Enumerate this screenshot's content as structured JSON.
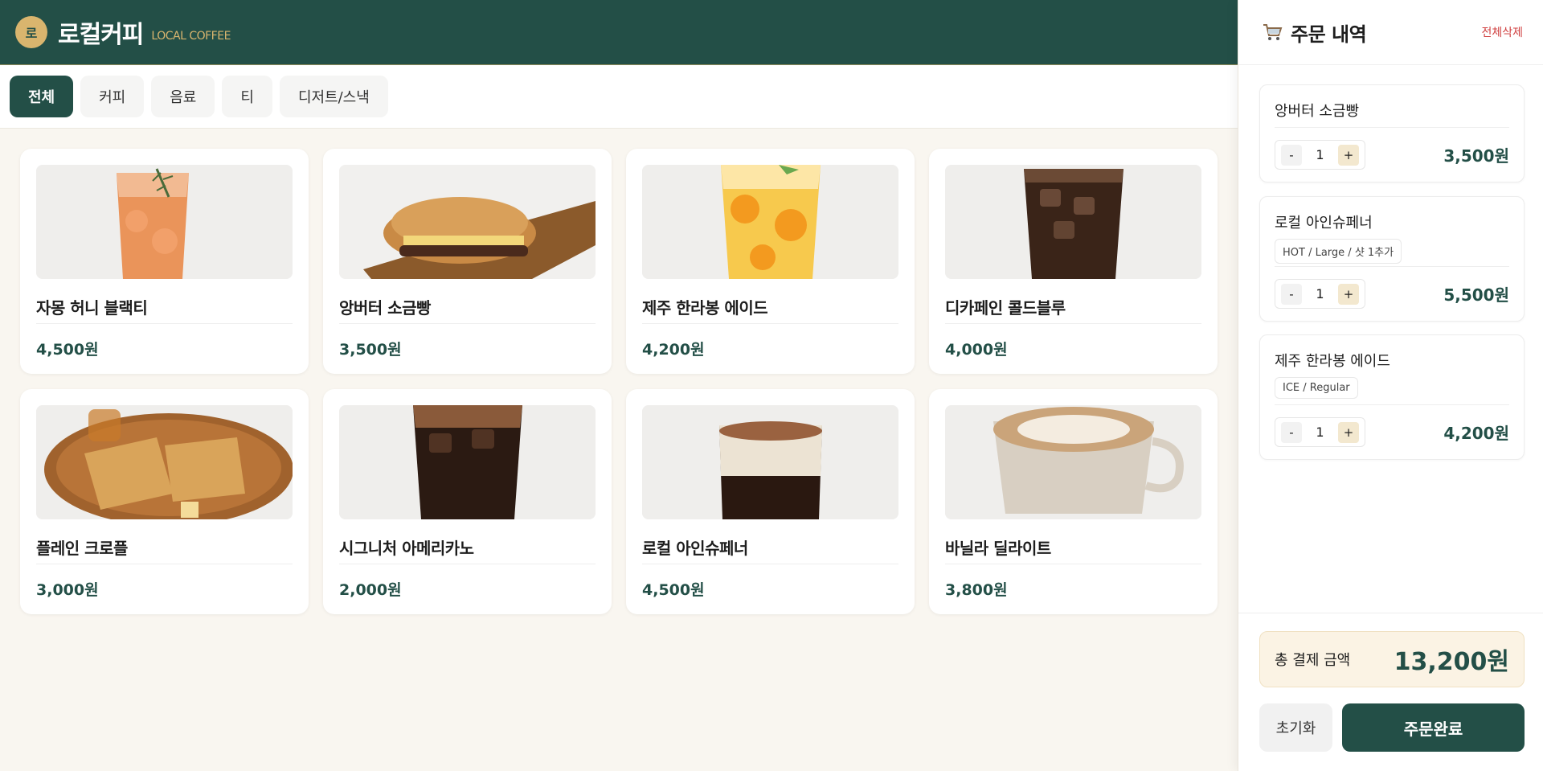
{
  "header": {
    "logo_char": "로",
    "title": "로컬커피",
    "subtitle": "LOCAL COFFEE"
  },
  "tabs": [
    {
      "label": "전체",
      "active": true
    },
    {
      "label": "커피",
      "active": false
    },
    {
      "label": "음료",
      "active": false
    },
    {
      "label": "티",
      "active": false
    },
    {
      "label": "디저트/스낵",
      "active": false
    }
  ],
  "menu": [
    {
      "name": "자몽 허니 블랙티",
      "price": "4,500원",
      "image": "grapefruit-tea-image"
    },
    {
      "name": "앙버터 소금빵",
      "price": "3,500원",
      "image": "salt-bread-image"
    },
    {
      "name": "제주 한라봉 에이드",
      "price": "4,200원",
      "image": "hallabong-ade-image"
    },
    {
      "name": "디카페인 콜드블루",
      "price": "4,000원",
      "image": "decaf-cold-brew-image"
    },
    {
      "name": "플레인 크로플",
      "price": "3,000원",
      "image": "croffle-image"
    },
    {
      "name": "시그니처 아메리카노",
      "price": "2,000원",
      "image": "americano-image"
    },
    {
      "name": "로컬 아인슈페너",
      "price": "4,500원",
      "image": "einspanner-image"
    },
    {
      "name": "바닐라 딜라이트",
      "price": "3,800원",
      "image": "vanilla-latte-image"
    }
  ],
  "cart": {
    "title": "주문 내역",
    "clear_all": "전체삭제",
    "items": [
      {
        "name": "앙버터 소금빵",
        "option": "",
        "qty": "1",
        "price": "3,500원"
      },
      {
        "name": "로컬 아인슈페너",
        "option": "HOT / Large / 샷 1추가",
        "qty": "1",
        "price": "5,500원"
      },
      {
        "name": "제주 한라봉 에이드",
        "option": "ICE / Regular",
        "qty": "1",
        "price": "4,200원"
      }
    ],
    "minus_label": "-",
    "plus_label": "+",
    "total_label": "총 결제 금액",
    "total_value": "13,200원",
    "reset_label": "초기화",
    "order_label": "주문완료"
  },
  "colors": {
    "primary": "#234f47",
    "accent": "#d9b56e",
    "danger": "#d04040",
    "background": "#f9f6f0"
  }
}
